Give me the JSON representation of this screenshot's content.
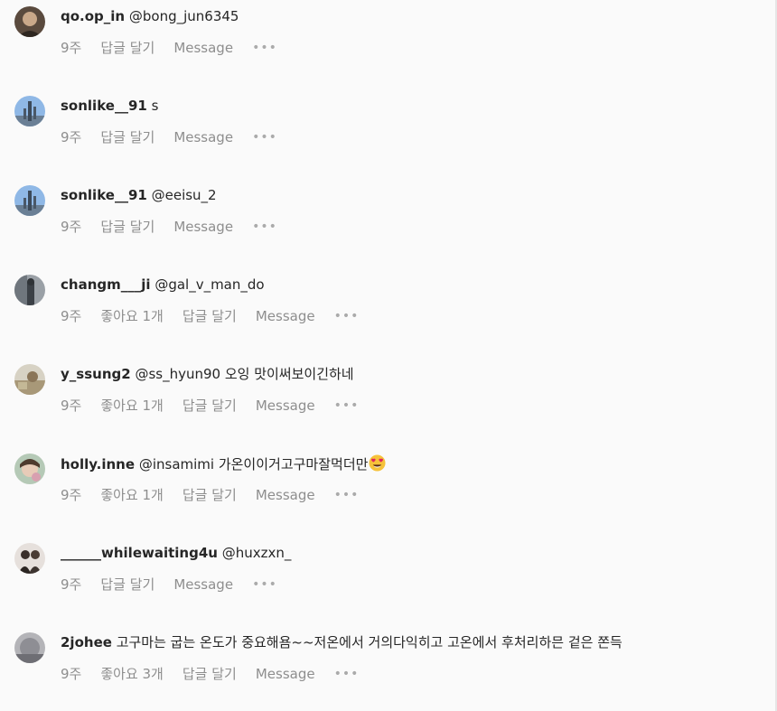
{
  "comments": [
    {
      "username": "qo.op_in",
      "text": "@bong_jun6345",
      "time": "9주",
      "likes": "",
      "reply": "답글 달기",
      "message": "Message",
      "more": "•••",
      "avatar": "dark"
    },
    {
      "username": "sonlike__91",
      "text": "s",
      "time": "9주",
      "likes": "",
      "reply": "답글 달기",
      "message": "Message",
      "more": "•••",
      "avatar": "sky-tower"
    },
    {
      "username": "sonlike__91",
      "text": "@eeisu_2",
      "time": "9주",
      "likes": "",
      "reply": "답글 달기",
      "message": "Message",
      "more": "•••",
      "avatar": "sky-tower"
    },
    {
      "username": "changm___ji",
      "text": "@gal_v_man_do",
      "time": "9주",
      "likes": "좋아요 1개",
      "reply": "답글 달기",
      "message": "Message",
      "more": "•••",
      "avatar": "grey-figure"
    },
    {
      "username": "y_ssung2",
      "text": "@ss_hyun90 오잉 맛이써보이긴하네",
      "time": "9주",
      "likes": "좋아요 1개",
      "reply": "답글 달기",
      "message": "Message",
      "more": "•••",
      "avatar": "landscape"
    },
    {
      "username": "holly.inne",
      "text": "@insamimi 가온이이거고구마잘먹더만",
      "time": "9주",
      "likes": "좋아요 1개",
      "reply": "답글 달기",
      "message": "Message",
      "more": "•••",
      "avatar": "child",
      "emoji": "heart-eyes-emoji"
    },
    {
      "username": "______whilewaiting4u",
      "text": "@huxzxn_",
      "time": "9주",
      "likes": "",
      "reply": "답글 달기",
      "message": "Message",
      "more": "•••",
      "avatar": "couple"
    },
    {
      "username": "2johee",
      "text": "고구마는 굽는 온도가 중요해욤~~저온에서 거의다익히고 고온에서 후처리하믄 겉은 쫀득",
      "time": "9주",
      "likes": "좋아요 3개",
      "reply": "답글 달기",
      "message": "Message",
      "more": "•••",
      "avatar": "grey-blur"
    }
  ],
  "colors": {
    "username": "#262626",
    "meta": "#8e8e8e",
    "background": "#fafafa"
  }
}
